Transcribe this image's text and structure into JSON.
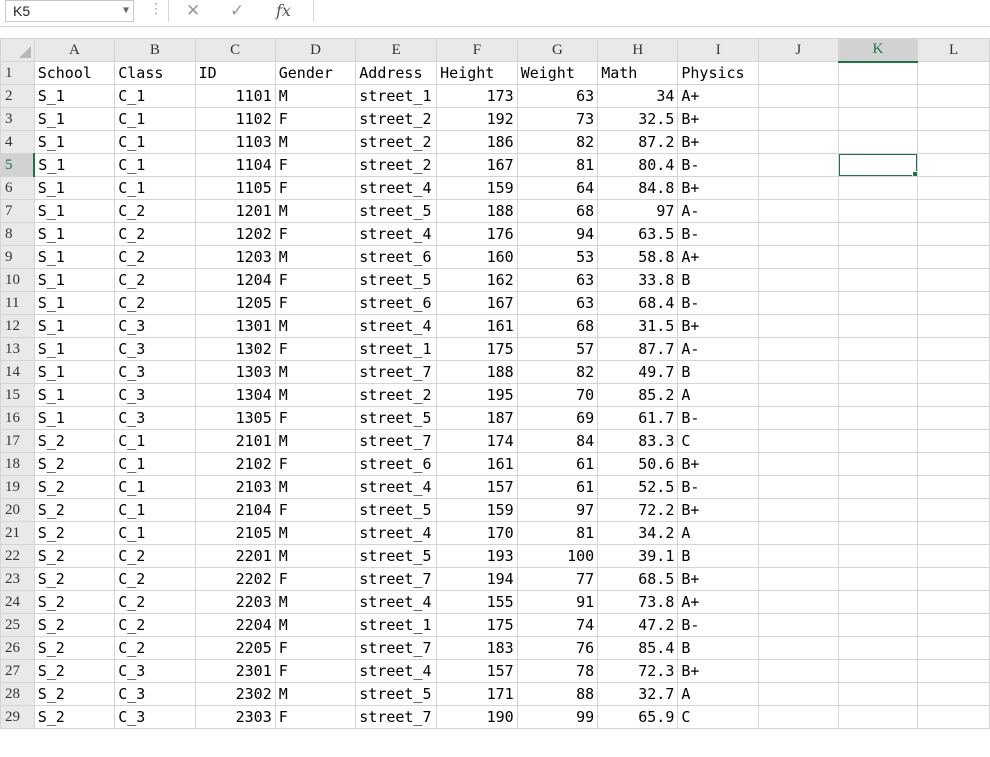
{
  "name_box": "K5",
  "formula_bar": {
    "cancel_icon": "✕",
    "enter_icon": "✓",
    "fx_icon": "fx",
    "content": ""
  },
  "accent_color": "#217346",
  "active_cell": {
    "column": "K",
    "row": "5"
  },
  "columns": [
    "A",
    "B",
    "C",
    "D",
    "E",
    "F",
    "G",
    "H",
    "I",
    "J",
    "K",
    "L"
  ],
  "rows": [
    [
      "School",
      "Class",
      "ID",
      "Gender",
      "Address",
      "Height",
      "Weight",
      "Math",
      "Physics",
      "",
      "",
      ""
    ],
    [
      "S_1",
      "C_1",
      "1101",
      "M",
      "street_1",
      "173",
      "63",
      "34",
      "A+",
      "",
      "",
      ""
    ],
    [
      "S_1",
      "C_1",
      "1102",
      "F",
      "street_2",
      "192",
      "73",
      "32.5",
      "B+",
      "",
      "",
      ""
    ],
    [
      "S_1",
      "C_1",
      "1103",
      "M",
      "street_2",
      "186",
      "82",
      "87.2",
      "B+",
      "",
      "",
      ""
    ],
    [
      "S_1",
      "C_1",
      "1104",
      "F",
      "street_2",
      "167",
      "81",
      "80.4",
      "B-",
      "",
      "",
      ""
    ],
    [
      "S_1",
      "C_1",
      "1105",
      "F",
      "street_4",
      "159",
      "64",
      "84.8",
      "B+",
      "",
      "",
      ""
    ],
    [
      "S_1",
      "C_2",
      "1201",
      "M",
      "street_5",
      "188",
      "68",
      "97",
      "A-",
      "",
      "",
      ""
    ],
    [
      "S_1",
      "C_2",
      "1202",
      "F",
      "street_4",
      "176",
      "94",
      "63.5",
      "B-",
      "",
      "",
      ""
    ],
    [
      "S_1",
      "C_2",
      "1203",
      "M",
      "street_6",
      "160",
      "53",
      "58.8",
      "A+",
      "",
      "",
      ""
    ],
    [
      "S_1",
      "C_2",
      "1204",
      "F",
      "street_5",
      "162",
      "63",
      "33.8",
      "B",
      "",
      "",
      ""
    ],
    [
      "S_1",
      "C_2",
      "1205",
      "F",
      "street_6",
      "167",
      "63",
      "68.4",
      "B-",
      "",
      "",
      ""
    ],
    [
      "S_1",
      "C_3",
      "1301",
      "M",
      "street_4",
      "161",
      "68",
      "31.5",
      "B+",
      "",
      "",
      ""
    ],
    [
      "S_1",
      "C_3",
      "1302",
      "F",
      "street_1",
      "175",
      "57",
      "87.7",
      "A-",
      "",
      "",
      ""
    ],
    [
      "S_1",
      "C_3",
      "1303",
      "M",
      "street_7",
      "188",
      "82",
      "49.7",
      "B",
      "",
      "",
      ""
    ],
    [
      "S_1",
      "C_3",
      "1304",
      "M",
      "street_2",
      "195",
      "70",
      "85.2",
      "A",
      "",
      "",
      ""
    ],
    [
      "S_1",
      "C_3",
      "1305",
      "F",
      "street_5",
      "187",
      "69",
      "61.7",
      "B-",
      "",
      "",
      ""
    ],
    [
      "S_2",
      "C_1",
      "2101",
      "M",
      "street_7",
      "174",
      "84",
      "83.3",
      "C",
      "",
      "",
      ""
    ],
    [
      "S_2",
      "C_1",
      "2102",
      "F",
      "street_6",
      "161",
      "61",
      "50.6",
      "B+",
      "",
      "",
      ""
    ],
    [
      "S_2",
      "C_1",
      "2103",
      "M",
      "street_4",
      "157",
      "61",
      "52.5",
      "B-",
      "",
      "",
      ""
    ],
    [
      "S_2",
      "C_1",
      "2104",
      "F",
      "street_5",
      "159",
      "97",
      "72.2",
      "B+",
      "",
      "",
      ""
    ],
    [
      "S_2",
      "C_1",
      "2105",
      "M",
      "street_4",
      "170",
      "81",
      "34.2",
      "A",
      "",
      "",
      ""
    ],
    [
      "S_2",
      "C_2",
      "2201",
      "M",
      "street_5",
      "193",
      "100",
      "39.1",
      "B",
      "",
      "",
      ""
    ],
    [
      "S_2",
      "C_2",
      "2202",
      "F",
      "street_7",
      "194",
      "77",
      "68.5",
      "B+",
      "",
      "",
      ""
    ],
    [
      "S_2",
      "C_2",
      "2203",
      "M",
      "street_4",
      "155",
      "91",
      "73.8",
      "A+",
      "",
      "",
      ""
    ],
    [
      "S_2",
      "C_2",
      "2204",
      "M",
      "street_1",
      "175",
      "74",
      "47.2",
      "B-",
      "",
      "",
      ""
    ],
    [
      "S_2",
      "C_2",
      "2205",
      "F",
      "street_7",
      "183",
      "76",
      "85.4",
      "B",
      "",
      "",
      ""
    ],
    [
      "S_2",
      "C_3",
      "2301",
      "F",
      "street_4",
      "157",
      "78",
      "72.3",
      "B+",
      "",
      "",
      ""
    ],
    [
      "S_2",
      "C_3",
      "2302",
      "M",
      "street_5",
      "171",
      "88",
      "32.7",
      "A",
      "",
      "",
      ""
    ],
    [
      "S_2",
      "C_3",
      "2303",
      "F",
      "street_7",
      "190",
      "99",
      "65.9",
      "C",
      "",
      "",
      ""
    ]
  ]
}
